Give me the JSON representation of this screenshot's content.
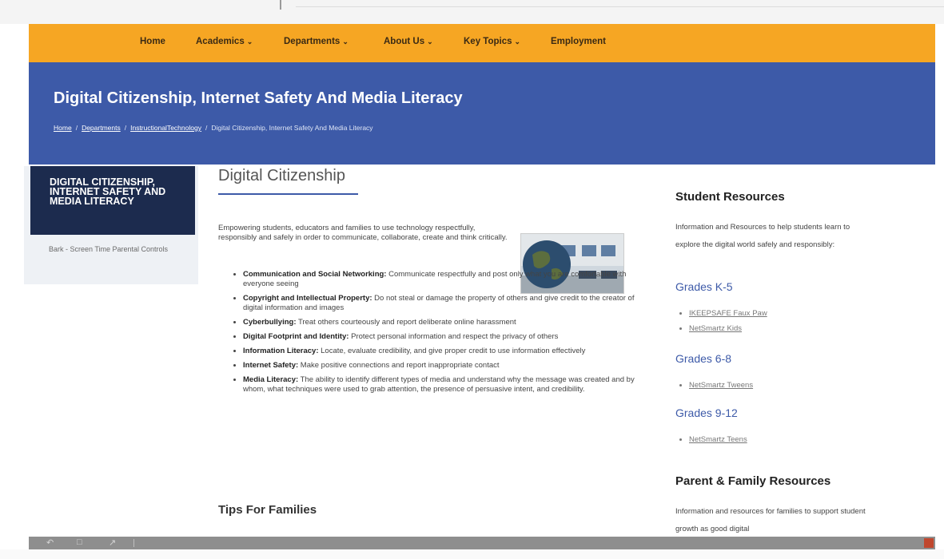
{
  "nav": {
    "items": [
      {
        "label": "Home",
        "dropdown": false
      },
      {
        "label": "Academics",
        "dropdown": true
      },
      {
        "label": "Departments",
        "dropdown": true
      },
      {
        "label": "About Us",
        "dropdown": true
      },
      {
        "label": "Key Topics",
        "dropdown": true
      },
      {
        "label": "Employment",
        "dropdown": false
      }
    ],
    "chevron": "⌄"
  },
  "banner": {
    "title": "Digital Citizenship, Internet Safety And Media Literacy",
    "breadcrumb": {
      "home": "Home",
      "departments": "Departments",
      "instructional_technology": "InstructionalTechnology",
      "current": "Digital Citizenship, Internet Safety And Media Literacy",
      "separator": "/"
    }
  },
  "sidebar": {
    "heading": "DIGITAL CITIZENSHIP, INTERNET SAFETY AND MEDIA LITERACY",
    "link": "Bark - Screen Time Parental Controls"
  },
  "main": {
    "title": "Digital Citizenship",
    "intro": "Empowering students, educators and families to use technology respectfully, responsibly and safely in order to communicate, collaborate, create and think critically.",
    "bullets": [
      {
        "term": "Communication and Social Networking:",
        "text": "Communicate respectfully and post only what you are comfortable with everyone seeing"
      },
      {
        "term": "Copyright and Intellectual Property:",
        "text": "Do not steal or damage the property of others and give credit to the creator of digital information and images"
      },
      {
        "term": "Cyberbullying:",
        "text": "Treat others courteously and report deliberate online harassment"
      },
      {
        "term": "Digital Footprint and Identity:",
        "text": "Protect personal information and respect the privacy of others"
      },
      {
        "term": "Information Literacy:",
        "text": "Locate, evaluate credibility, and give proper credit to use information effectively"
      },
      {
        "term": "Internet Safety:",
        "text": "Make positive connections and report inappropriate contact"
      },
      {
        "term": "Media Literacy:",
        "text": "The ability to identify different types of media and understand why the message was created and by whom, what techniques were used to grab attention, the presence of persuasive intent, and credibility."
      }
    ],
    "tips_heading": "Tips For Families"
  },
  "resources": {
    "student_title": "Student Resources",
    "student_text": "Information and Resources to help students learn to explore the digital world safely and responsibly:",
    "grades_k5": {
      "label": "Grades K-5",
      "links": [
        "IKEEPSAFE Faux Paw",
        "NetSmartz Kids"
      ]
    },
    "grades_68": {
      "label": "Grades 6-8",
      "links": [
        "NetSmartz Tweens"
      ]
    },
    "grades_912": {
      "label": "Grades 9-12",
      "links": [
        "NetSmartz Teens"
      ]
    },
    "parent_title": "Parent & Family Resources",
    "parent_text": "Information and resources for families to support student growth as good digital"
  },
  "colors": {
    "nav": "#f6a623",
    "banner": "#3d5aa8",
    "sidebar_heading": "#1c2b4e",
    "accent": "#3d5aa8"
  },
  "icons": {
    "bottom_bar": [
      "undo-icon",
      "window-icon",
      "share-icon"
    ]
  }
}
